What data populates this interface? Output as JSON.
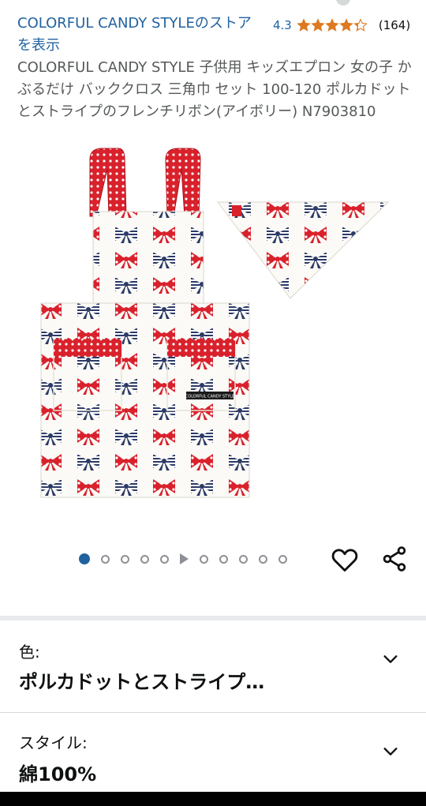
{
  "store": {
    "link_text": "COLORFUL CANDY STYLEのストアを表示"
  },
  "rating": {
    "value": "4.3",
    "stars": 4.3,
    "count": "(164)"
  },
  "product": {
    "title": "COLORFUL CANDY STYLE 子供用 キッズエプロン 女の子 かぶるだけ バッククロス 三角巾 セット 100-120 ポルカドットとストライプのフレンチリボン(アイボリー) N7903810",
    "image_label": "COLORFUL CANDY STYLE"
  },
  "carousel": {
    "total_images": 11,
    "active_index": 0,
    "video_index": 5
  },
  "options": {
    "color": {
      "label": "色:",
      "value": "ポルカドットとストライプ…"
    },
    "style": {
      "label": "スタイル:",
      "value": "綿100%"
    }
  },
  "colors": {
    "link": "#2162a1",
    "star": "#de7921",
    "ribbon_red": "#d9212c",
    "ribbon_navy": "#2b3a67"
  },
  "icons": [
    "star-icon",
    "heart-icon",
    "share-icon",
    "chevron-down-icon",
    "play-icon"
  ]
}
